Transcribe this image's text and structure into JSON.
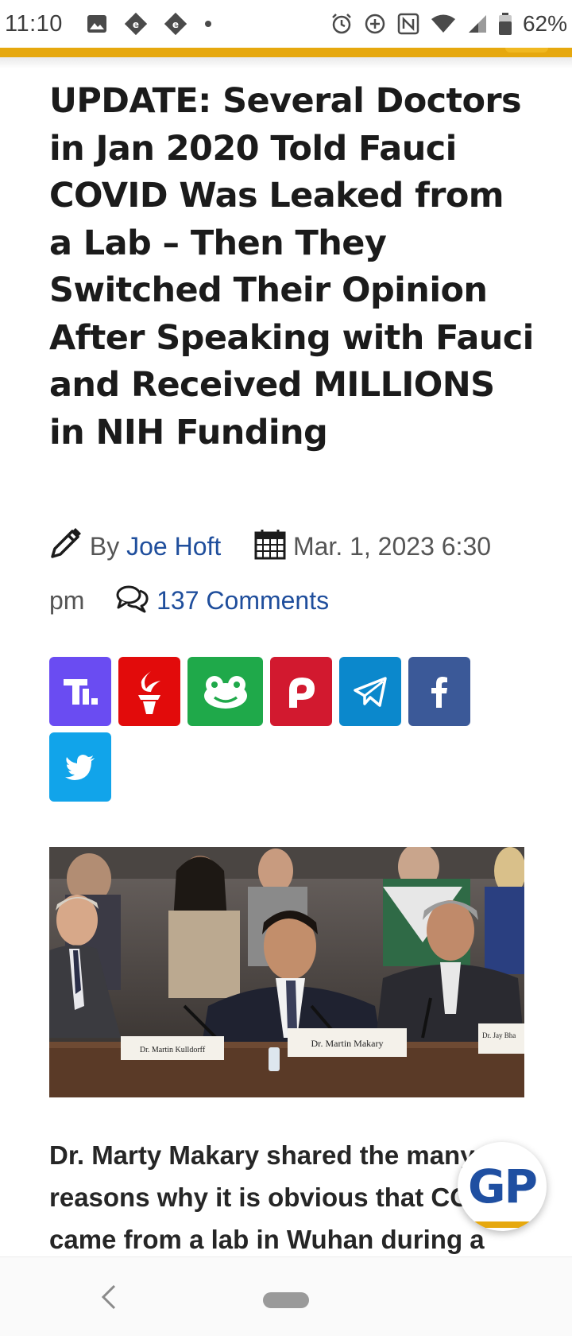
{
  "status_bar": {
    "time": "11:10",
    "battery_percent": "62%",
    "icons": [
      "image-icon",
      "app-notification-icon",
      "app-notification-icon",
      "dot-icon",
      "alarm-icon",
      "data-saver-icon",
      "nfc-icon",
      "wifi-icon",
      "signal-icon",
      "battery-icon"
    ]
  },
  "theme": {
    "accent": "#e6a80e",
    "link": "#1f4e9c",
    "brand_blue": "#1f4fa1"
  },
  "article": {
    "headline": "UPDATE: Several Doctors in Jan 2020 Told Fauci COVID Was Leaked from a Lab – Then They Switched Their Opinion After Speaking with Fauci and Received MILLIONS in NIH Funding",
    "by_label": "By",
    "author": "Joe Hoft",
    "date": "Mar. 1, 2023 6:30 pm",
    "comments": "137 Comments",
    "body": "Dr. Marty Makary shared the many reasons why it is obvious that COVID came from a lab in Wuhan during a"
  },
  "share_buttons": [
    {
      "name": "truth-social",
      "color": "#6a4cf2"
    },
    {
      "name": "gettr",
      "color": "#e20b0b"
    },
    {
      "name": "gab",
      "color": "#1fa94a"
    },
    {
      "name": "parler",
      "color": "#d2192f"
    },
    {
      "name": "telegram",
      "color": "#0b88cc"
    },
    {
      "name": "facebook",
      "color": "#3b5998"
    },
    {
      "name": "twitter",
      "color": "#11a4ea"
    }
  ],
  "photo": {
    "placards": [
      "Dr. Martin Kulldorff",
      "Dr. Martin Makary",
      "Dr. Jay Bha"
    ]
  },
  "badge": {
    "label": "GP"
  }
}
